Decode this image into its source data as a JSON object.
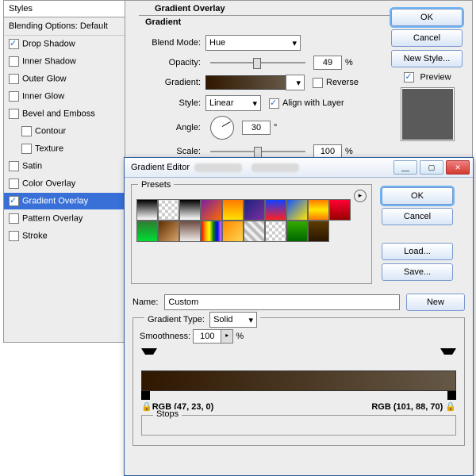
{
  "layerStyle": {
    "panelTitle": "Styles",
    "blendingHeader": "Blending Options: Default",
    "items": [
      {
        "label": "Drop Shadow",
        "checked": true
      },
      {
        "label": "Inner Shadow",
        "checked": false
      },
      {
        "label": "Outer Glow",
        "checked": false
      },
      {
        "label": "Inner Glow",
        "checked": false
      },
      {
        "label": "Bevel and Emboss",
        "checked": false
      },
      {
        "label": "Contour",
        "checked": false,
        "indent": true
      },
      {
        "label": "Texture",
        "checked": false,
        "indent": true
      },
      {
        "label": "Satin",
        "checked": false
      },
      {
        "label": "Color Overlay",
        "checked": false
      },
      {
        "label": "Gradient Overlay",
        "checked": true,
        "selected": true
      },
      {
        "label": "Pattern Overlay",
        "checked": false
      },
      {
        "label": "Stroke",
        "checked": false
      }
    ],
    "group": {
      "title": "Gradient Overlay",
      "subtitle": "Gradient",
      "blendModeLabel": "Blend Mode:",
      "blendMode": "Hue",
      "opacityLabel": "Opacity:",
      "opacity": "49",
      "opacityUnit": "%",
      "gradientLabel": "Gradient:",
      "reverseLabel": "Reverse",
      "styleLabel": "Style:",
      "style": "Linear",
      "alignLabel": "Align with Layer",
      "angleLabel": "Angle:",
      "angle": "30",
      "angleUnit": "°",
      "scaleLabel": "Scale:",
      "scale": "100",
      "scaleUnit": "%"
    },
    "buttons": {
      "ok": "OK",
      "cancel": "Cancel",
      "newStyle": "New Style...",
      "previewLabel": "Preview"
    }
  },
  "gradientEditor": {
    "title": "Gradient Editor",
    "presetsLabel": "Presets",
    "buttons": {
      "ok": "OK",
      "cancel": "Cancel",
      "load": "Load...",
      "save": "Save...",
      "new": "New"
    },
    "nameLabel": "Name:",
    "name": "Custom",
    "gradientTypeLabel": "Gradient Type:",
    "gradientType": "Solid",
    "smoothnessLabel": "Smoothness:",
    "smoothness": "100",
    "smoothnessUnit": "%",
    "leftStop": "RGB (47, 23, 0)",
    "rightStop": "RGB (101, 88, 70)",
    "stopsLabel": "Stops",
    "swatches": [
      "linear-gradient(#000,#fff)",
      "repeating-conic-gradient(#ccc 0 25%,#fff 0 50%) 0/8px 8px",
      "linear-gradient(#000,#fff)",
      "linear-gradient(135deg,#7a1fa2,#ff6a00)",
      "linear-gradient(#ff7a00,#ffe100)",
      "linear-gradient(135deg,#1a237e,#7d2fa0)",
      "linear-gradient(#1040ff,#ff2020)",
      "linear-gradient(135deg,#1455ff,#ffe600)",
      "linear-gradient(#ff7a00,#ffe600,#ff7a00)",
      "linear-gradient(#f03,#900)",
      "linear-gradient(#2e7d32,#0d3)",
      "linear-gradient(135deg,#5d2e00,#d9a26b)",
      "linear-gradient(#6d4c41,#efebe9)",
      "linear-gradient(90deg,red,orange,yellow,green,blue,violet)",
      "linear-gradient(135deg,#ff8a00,#ffd54f)",
      "repeating-linear-gradient(45deg,#bbb 0 4px,#eee 4px 8px)",
      "repeating-conic-gradient(#ccc 0 25%,#fff 0 50%) 0/8px 8px",
      "linear-gradient(#3a0,#060)",
      "linear-gradient(#5d3a00,#2a1700)"
    ]
  }
}
